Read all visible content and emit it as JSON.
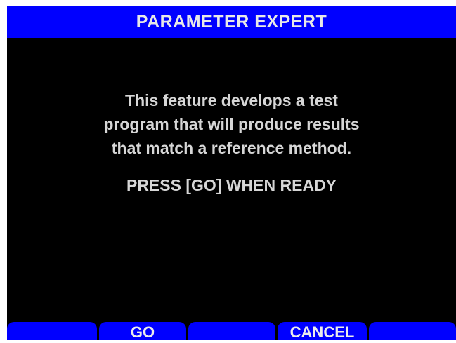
{
  "header": {
    "title": "PARAMETER EXPERT"
  },
  "message": {
    "lines": [
      "This feature develops a test",
      "program that will produce results",
      "that match a reference method."
    ],
    "prompt": "PRESS [GO] WHEN READY"
  },
  "softkeys": [
    {
      "label": ""
    },
    {
      "label": "GO"
    },
    {
      "label": ""
    },
    {
      "label": "CANCEL"
    },
    {
      "label": ""
    }
  ],
  "colors": {
    "title_bar": "#0000ff",
    "softkey": "#0000ff",
    "background": "#000000",
    "text": "#d6d6d6"
  }
}
